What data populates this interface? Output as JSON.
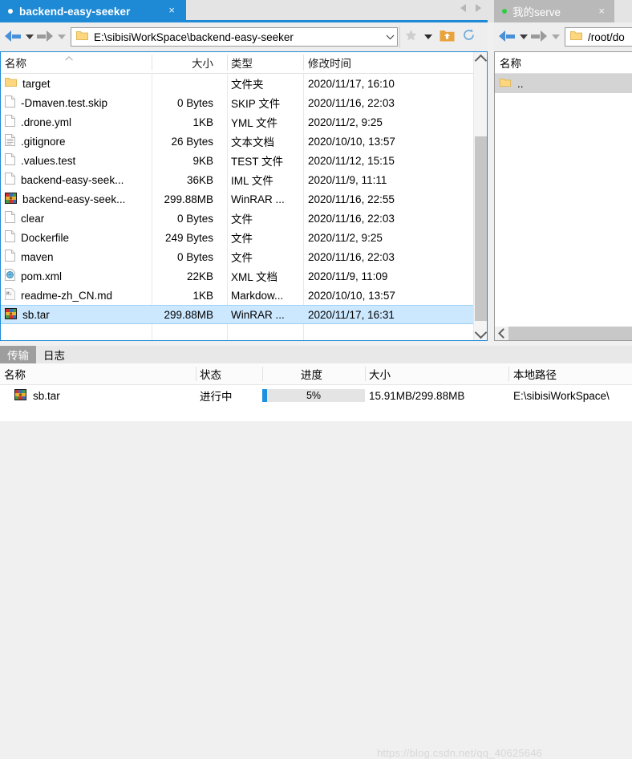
{
  "left": {
    "tab": {
      "title": "backend-easy-seeker",
      "close": "×",
      "status_dot": "connected-dot"
    },
    "toolbar": {
      "back_icon": "back-arrow-icon",
      "forward_icon": "forward-arrow-icon",
      "address_value": "E:\\sibisiWorkSpace\\backend-easy-seeker",
      "favorite_icon": "star-icon",
      "up_icon": "up-folder-icon",
      "refresh_icon": "refresh-icon"
    },
    "columns": [
      "名称",
      "大小",
      "类型",
      "修改时间"
    ],
    "files": [
      {
        "name": "target",
        "size": "",
        "type": "文件夹",
        "date": "2020/11/17, 16:10",
        "icon": "folder-icon",
        "selected": false
      },
      {
        "name": "-Dmaven.test.skip",
        "size": "0 Bytes",
        "type": "SKIP 文件",
        "date": "2020/11/16, 22:03",
        "icon": "file-icon",
        "selected": false
      },
      {
        "name": ".drone.yml",
        "size": "1KB",
        "type": "YML 文件",
        "date": "2020/11/2, 9:25",
        "icon": "file-icon",
        "selected": false
      },
      {
        "name": ".gitignore",
        "size": "26 Bytes",
        "type": "文本文档",
        "date": "2020/10/10, 13:57",
        "icon": "text-file-icon",
        "selected": false
      },
      {
        "name": ".values.test",
        "size": "9KB",
        "type": "TEST 文件",
        "date": "2020/11/12, 15:15",
        "icon": "file-icon",
        "selected": false
      },
      {
        "name": "backend-easy-seek...",
        "size": "36KB",
        "type": "IML 文件",
        "date": "2020/11/9, 11:11",
        "icon": "file-icon",
        "selected": false
      },
      {
        "name": "backend-easy-seek...",
        "size": "299.88MB",
        "type": "WinRAR ...",
        "date": "2020/11/16, 22:55",
        "icon": "winrar-icon",
        "selected": false
      },
      {
        "name": "clear",
        "size": "0 Bytes",
        "type": "文件",
        "date": "2020/11/16, 22:03",
        "icon": "file-icon",
        "selected": false
      },
      {
        "name": "Dockerfile",
        "size": "249 Bytes",
        "type": "文件",
        "date": "2020/11/2, 9:25",
        "icon": "file-icon",
        "selected": false
      },
      {
        "name": "maven",
        "size": "0 Bytes",
        "type": "文件",
        "date": "2020/11/16, 22:03",
        "icon": "file-icon",
        "selected": false
      },
      {
        "name": "pom.xml",
        "size": "22KB",
        "type": "XML 文档",
        "date": "2020/11/9, 11:09",
        "icon": "xml-icon",
        "selected": false
      },
      {
        "name": "readme-zh_CN.md",
        "size": "1KB",
        "type": "Markdow...",
        "date": "2020/10/10, 13:57",
        "icon": "markdown-icon",
        "selected": false
      },
      {
        "name": "sb.tar",
        "size": "299.88MB",
        "type": "WinRAR ...",
        "date": "2020/11/17, 16:31",
        "icon": "winrar-icon",
        "selected": true
      }
    ]
  },
  "right": {
    "tab": {
      "title": "我的serve",
      "close": "×",
      "status_dot": "online-dot"
    },
    "toolbar": {
      "address_value": "/root/do",
      "back_icon": "back-arrow-icon",
      "forward_icon": "forward-arrow-icon"
    },
    "column_name": "名称",
    "files": [
      {
        "name": "..",
        "icon": "folder-icon"
      }
    ]
  },
  "bottom": {
    "tabs": [
      {
        "label": "传输",
        "active": true
      },
      {
        "label": "日志",
        "active": false
      }
    ],
    "columns": [
      "名称",
      "状态",
      "进度",
      "大小",
      "本地路径"
    ],
    "transfers": [
      {
        "name": "sb.tar",
        "icon": "winrar-icon",
        "status": "进行中",
        "progress_percent": 5,
        "progress_label": "5%",
        "size": "15.91MB/299.88MB",
        "local_path": "E:\\sibisiWorkSpace\\"
      }
    ]
  },
  "watermark": "https://blog.csdn.net/qq_40625646",
  "colors": {
    "accent_blue": "#1e8ad6",
    "progress_blue": "#1e90e0",
    "selection_blue": "#cce8ff",
    "online_green": "#2ecc40",
    "folder_yellow": "#fcd77f"
  }
}
